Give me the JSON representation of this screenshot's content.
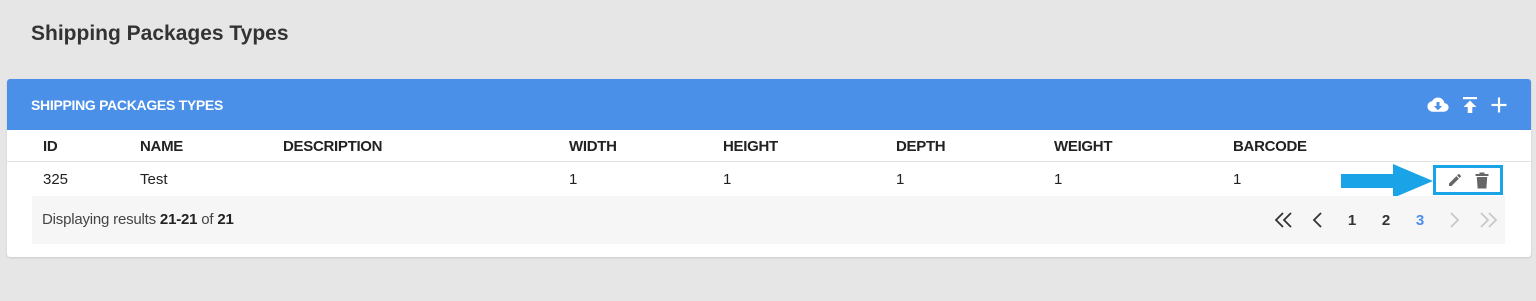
{
  "page": {
    "title": "Shipping Packages Types"
  },
  "card": {
    "title": "SHIPPING PACKAGES TYPES",
    "actions": [
      "download-cloud-icon",
      "upload-icon",
      "plus-icon"
    ]
  },
  "table": {
    "columns": [
      "ID",
      "NAME",
      "DESCRIPTION",
      "WIDTH",
      "HEIGHT",
      "DEPTH",
      "WEIGHT",
      "BARCODE"
    ],
    "rows": [
      {
        "id": "325",
        "name": "Test",
        "description": "",
        "width": "1",
        "height": "1",
        "depth": "1",
        "weight": "1",
        "barcode": "1"
      }
    ],
    "row_actions": [
      "edit-pencil-icon",
      "delete-trash-icon"
    ]
  },
  "footer": {
    "prefix": "Displaying results",
    "range": "21-21",
    "of_label": "of",
    "total": "21"
  },
  "pagination": {
    "pages": [
      "1",
      "2",
      "3"
    ],
    "current": "3"
  },
  "colors": {
    "header_bg": "#4a8fe8",
    "highlight": "#1aa3e6",
    "active_page": "#4a8fe8"
  }
}
